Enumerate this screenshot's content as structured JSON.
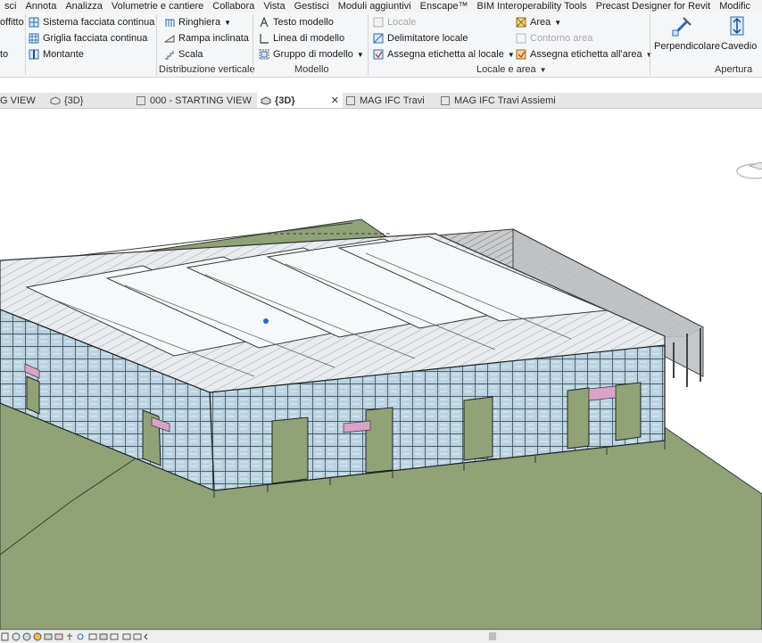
{
  "menu": [
    "sci",
    "Annota",
    "Analizza",
    "Volumetrie e cantiere",
    "Collabora",
    "Vista",
    "Gestisci",
    "Moduli aggiuntivi",
    "Enscape™",
    "BIM Interoperability Tools",
    "Precast Designer for Revit",
    "Modific"
  ],
  "ribbon": {
    "left_cut": {
      "item1": "offitto",
      "item2": "to"
    },
    "facciata": {
      "item1": "Sistema facciata continua",
      "item2": "Griglia facciata continua",
      "item3": "Montante"
    },
    "distribuzione": {
      "item1": "Ringhiera",
      "item2": "Rampa inclinata",
      "item3": "Scala",
      "label": "Distribuzione verticale"
    },
    "modello": {
      "item1": "Testo modello",
      "item2": "Linea di modello",
      "item3": "Gruppo di modello",
      "label": "Modello"
    },
    "locale": {
      "item1": "Locale",
      "item2": "Delimitatore  locale",
      "item3": "Assegna etichetta   al locale",
      "item4": "Area",
      "item5": "Contorno   area",
      "item6": "Assegna etichetta   all'area",
      "label": "Locale e area"
    },
    "apertura": {
      "item1": "Perpendicolare",
      "item2": "Cavedio",
      "label": "Apertura"
    }
  },
  "tabs": {
    "t1": "G VIEW",
    "t2": "{3D}",
    "t3": "000 - STARTING VIEW",
    "t4": "{3D}",
    "t5": "MAG  IFC  Travi",
    "t6": "MAG  IFC  Travi  Assiemi",
    "close": "✕"
  },
  "colors": {
    "ground": "#8fa377",
    "facade": "#a8c8d8",
    "accent": "#2b6cb8",
    "pink": "#d9a3c9"
  }
}
